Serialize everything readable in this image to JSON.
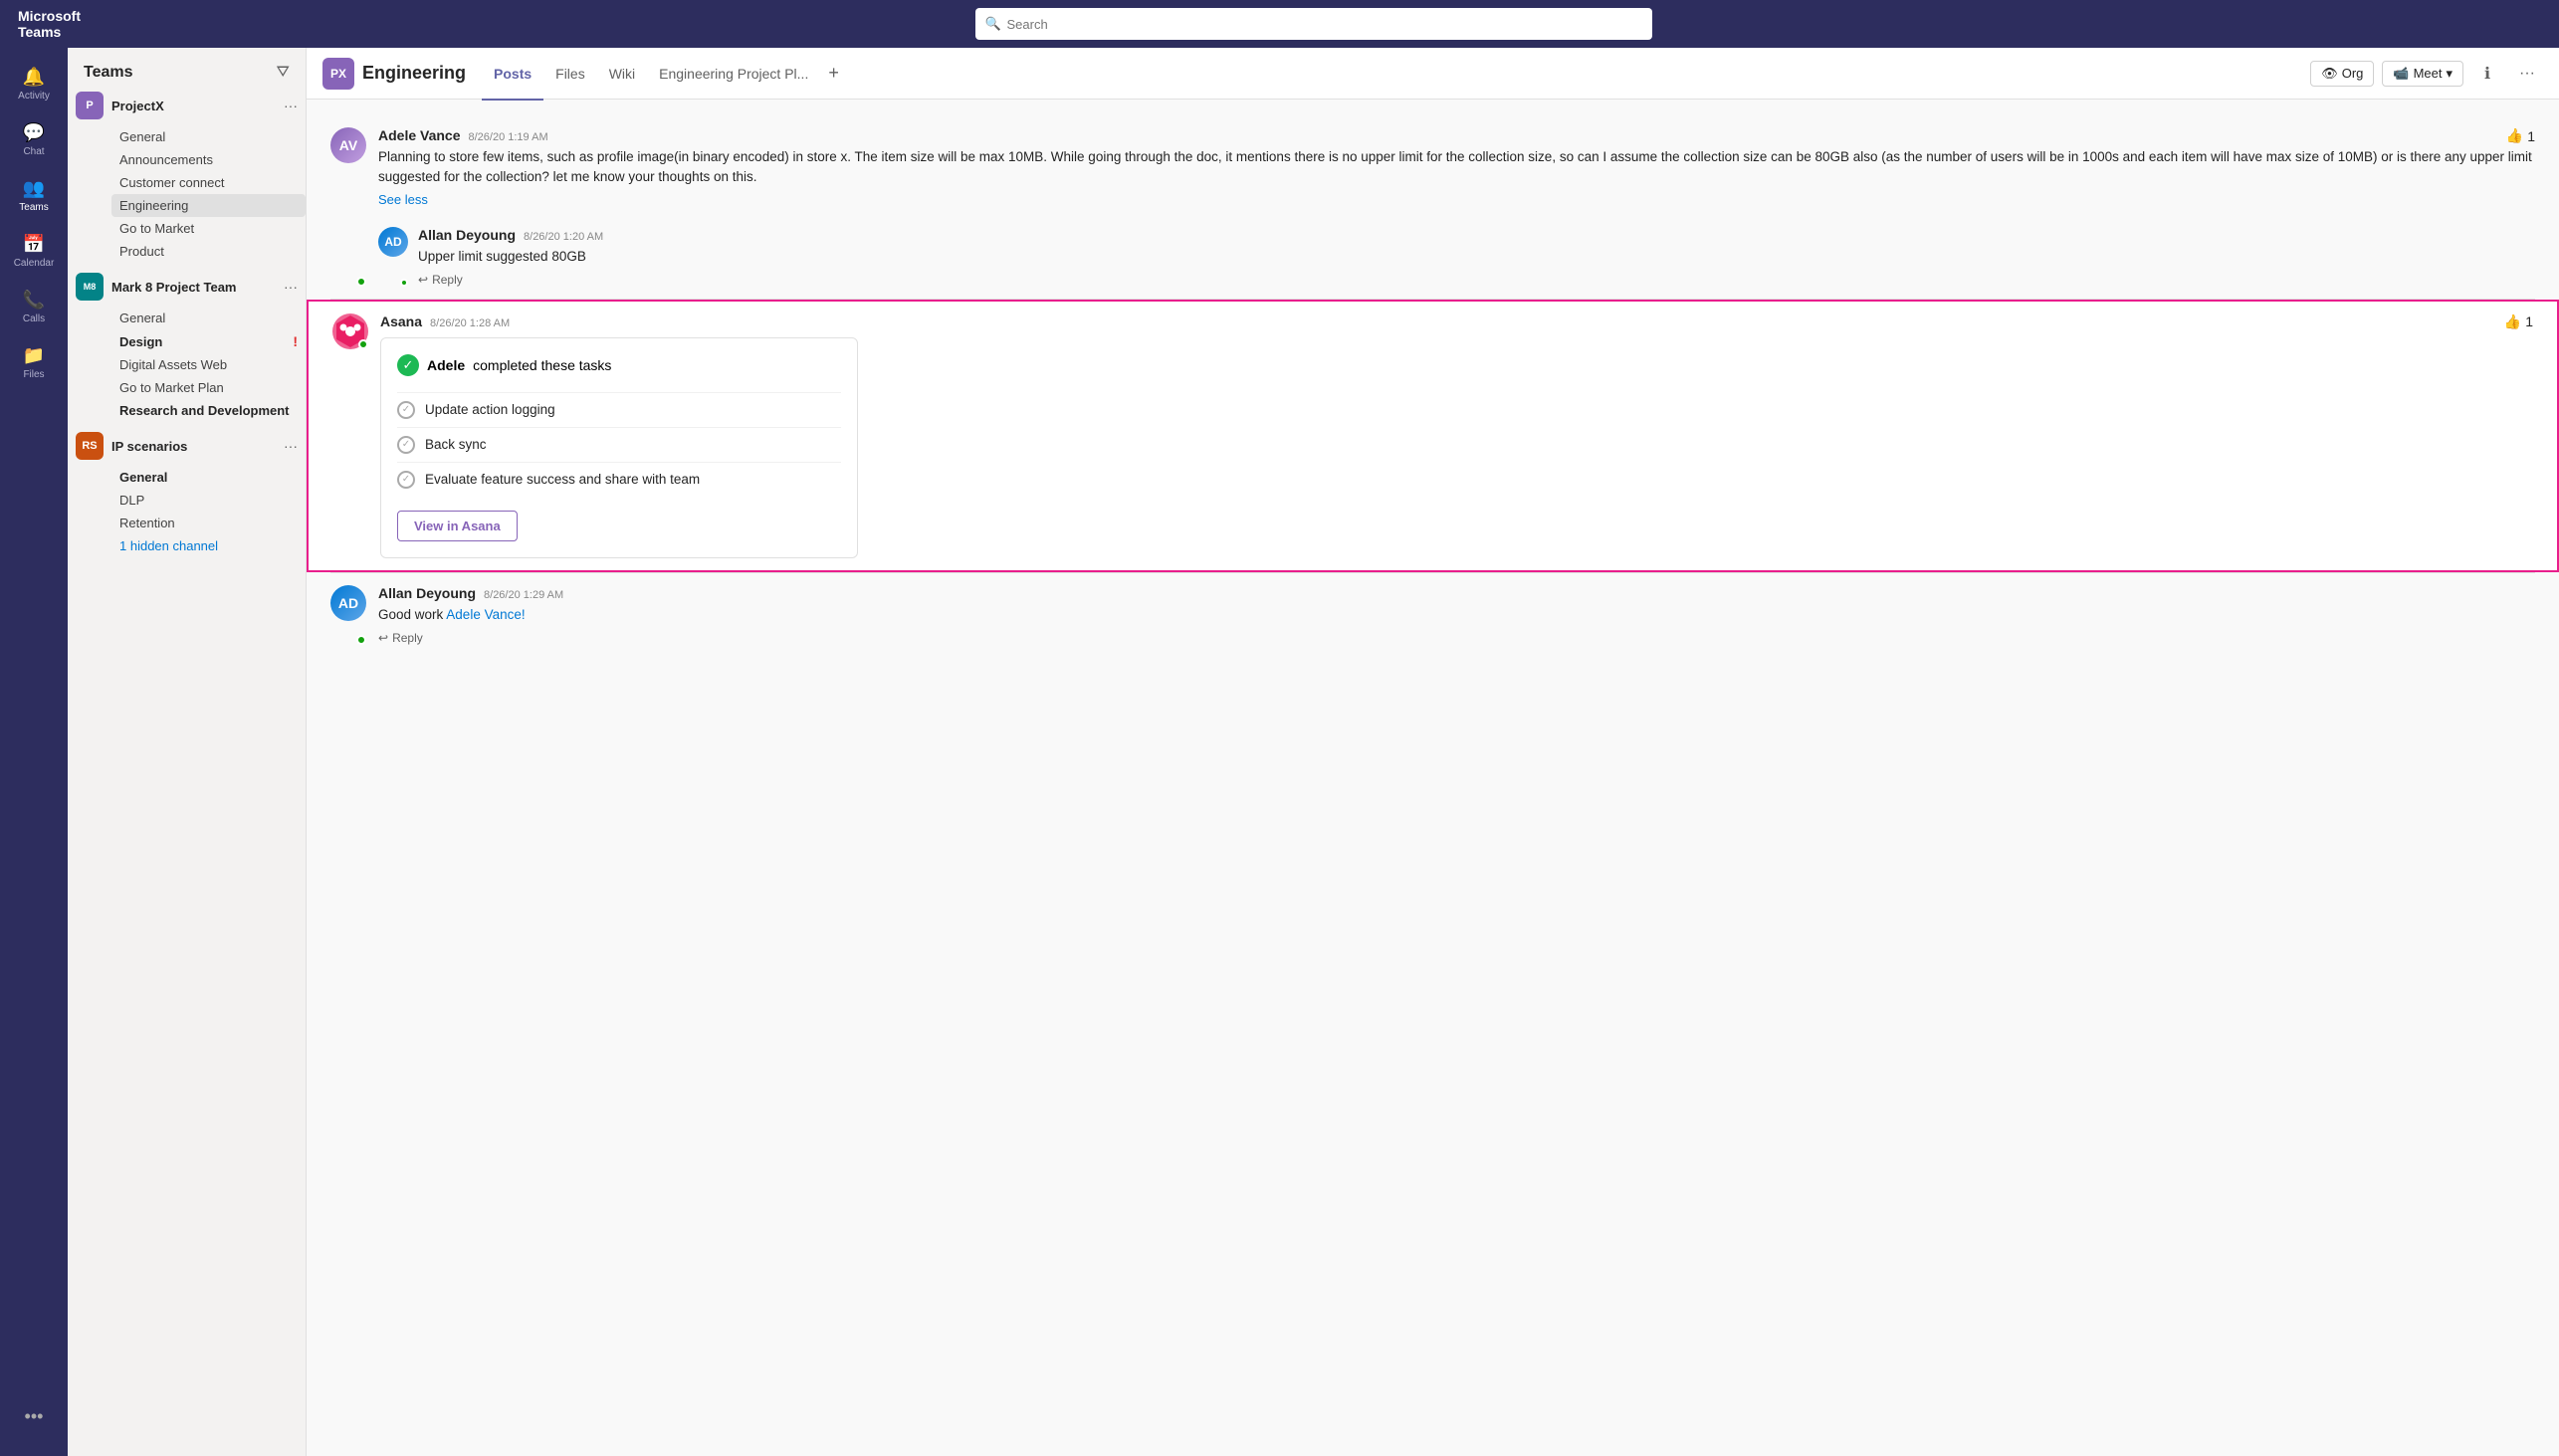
{
  "app": {
    "title": "Microsoft Teams"
  },
  "header": {
    "search_placeholder": "Search"
  },
  "sidebar": {
    "title": "Teams",
    "teams": [
      {
        "id": "projectx",
        "name": "ProjectX",
        "avatar_text": "P",
        "avatar_color": "#8764b8",
        "channels": [
          {
            "id": "general-px",
            "label": "General",
            "bold": false,
            "alert": false
          },
          {
            "id": "announcements-px",
            "label": "Announcements",
            "bold": false,
            "alert": false
          },
          {
            "id": "customer-connect",
            "label": "Customer connect",
            "bold": false,
            "alert": false
          },
          {
            "id": "engineering",
            "label": "Engineering",
            "bold": false,
            "alert": false,
            "active": true
          },
          {
            "id": "goto-market",
            "label": "Go to Market",
            "bold": true,
            "alert": false
          },
          {
            "id": "product",
            "label": "Product",
            "bold": false,
            "alert": false
          }
        ]
      },
      {
        "id": "mark8",
        "name": "Mark 8 Project Team",
        "avatar_text": "M8",
        "avatar_color": "#038387",
        "channels": [
          {
            "id": "general-m8",
            "label": "General",
            "bold": false,
            "alert": false
          },
          {
            "id": "design",
            "label": "Design",
            "bold": true,
            "alert": true
          },
          {
            "id": "digital-assets",
            "label": "Digital Assets Web",
            "bold": false,
            "alert": false
          },
          {
            "id": "goto-market-plan",
            "label": "Go to Market Plan",
            "bold": false,
            "alert": false
          },
          {
            "id": "research-dev",
            "label": "Research and Development",
            "bold": true,
            "alert": false
          }
        ]
      },
      {
        "id": "ipscenarios",
        "name": "IP scenarios",
        "avatar_text": "RS",
        "avatar_color": "#ca5010",
        "channels": [
          {
            "id": "general-ip",
            "label": "General",
            "bold": true,
            "alert": false
          },
          {
            "id": "dlp",
            "label": "DLP",
            "bold": false,
            "alert": false
          },
          {
            "id": "retention",
            "label": "Retention",
            "bold": false,
            "alert": false
          },
          {
            "id": "hidden-channel",
            "label": "1 hidden channel",
            "bold": false,
            "alert": false,
            "highlight": true
          }
        ]
      }
    ]
  },
  "channel": {
    "badge": "PX",
    "badge_color": "#8764b8",
    "name": "Engineering",
    "tabs": [
      {
        "id": "posts",
        "label": "Posts",
        "active": true
      },
      {
        "id": "files",
        "label": "Files",
        "active": false
      },
      {
        "id": "wiki",
        "label": "Wiki",
        "active": false
      },
      {
        "id": "eng-proj-pl",
        "label": "Engineering Project Pl...",
        "active": false
      }
    ],
    "actions": {
      "org": "Org",
      "meet": "Meet"
    }
  },
  "messages": [
    {
      "id": "msg1",
      "author": "Adele Vance",
      "time": "8/26/20 1:19 AM",
      "text": "Planning to store few items, such as profile image(in binary encoded) in store x. The item size will be max 10MB. While going through the doc, it mentions there is no upper limit for the collection size, so can I assume the collection size can be 80GB also (as the number of users will be in 1000s and each item will have max size of 10MB) or is there any upper limit suggested for the collection? let me know your thoughts on this.",
      "see_less": "See less",
      "reaction_emoji": "👍",
      "reaction_count": "1",
      "reply_label": "Reply",
      "avatar_type": "adele"
    },
    {
      "id": "msg2",
      "author": "Allan Deyoung",
      "time": "8/26/20 1:20 AM",
      "text": "Upper limit suggested 80GB",
      "reply_label": "Reply",
      "avatar_type": "allan"
    }
  ],
  "asana_message": {
    "author": "Asana",
    "time": "8/26/20 1:28 AM",
    "reaction_emoji": "👍",
    "reaction_count": "1",
    "completed_by": "Adele",
    "completed_text": "completed these tasks",
    "tasks": [
      {
        "id": "task1",
        "label": "Update action logging"
      },
      {
        "id": "task2",
        "label": "Back sync"
      },
      {
        "id": "task3",
        "label": "Evaluate feature success and share with team"
      }
    ],
    "view_button": "View in Asana"
  },
  "allan_reply": {
    "author": "Allan Deyoung",
    "time": "8/26/20 1:29 AM",
    "text_before": "Good work ",
    "mention": "Adele Vance!",
    "reply_label": "Reply",
    "avatar_type": "allan"
  },
  "nav": {
    "activity": "Activity",
    "chat": "Chat",
    "teams": "Teams",
    "calendar": "Calendar",
    "calls": "Calls",
    "files": "Files",
    "more": "..."
  }
}
